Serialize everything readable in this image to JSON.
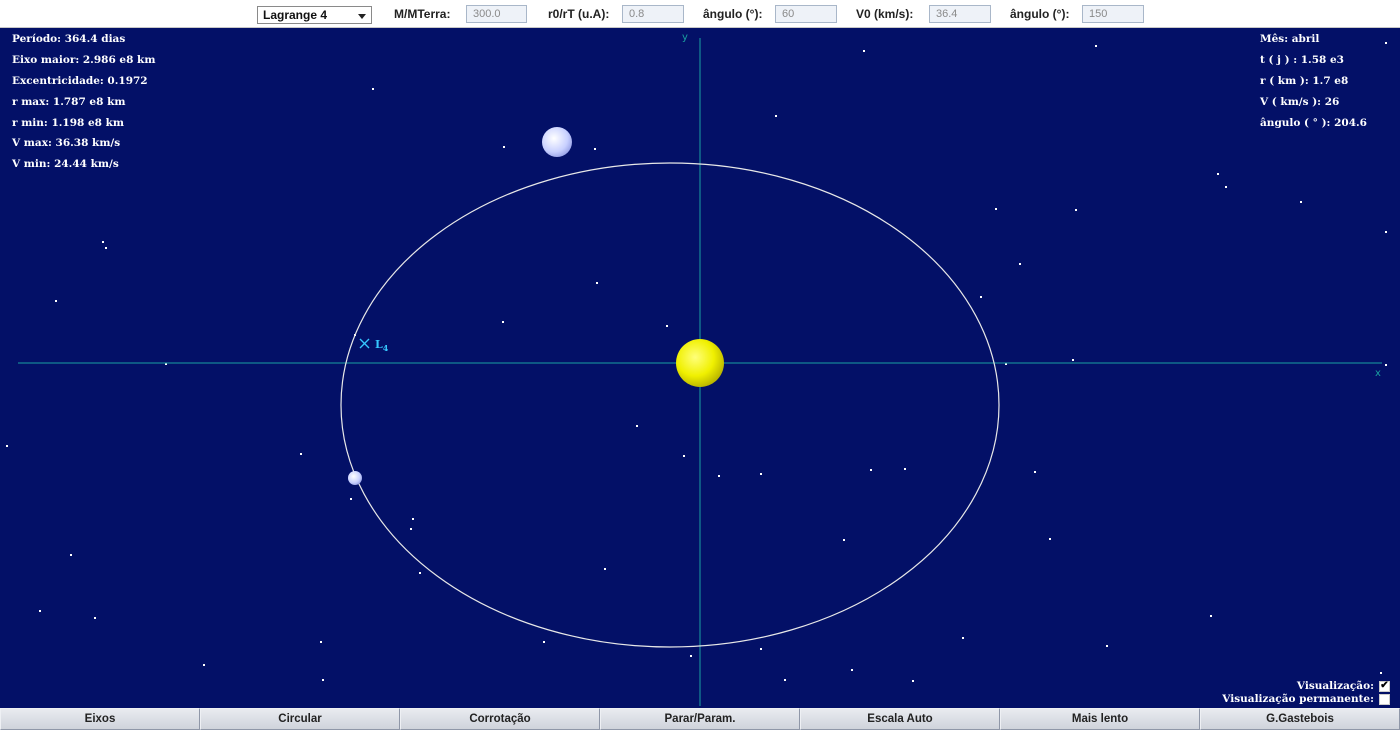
{
  "toolbar": {
    "mode_value": "Lagrange 4",
    "fields": [
      {
        "label": "M/MTerra:",
        "value": "300.0"
      },
      {
        "label": "r0/rT (u.A):",
        "value": "0.8"
      },
      {
        "label": "ângulo (°):",
        "value": "60"
      },
      {
        "label": "V0 (km/s):",
        "value": "36.4"
      },
      {
        "label": "ângulo (°):",
        "value": "150"
      }
    ]
  },
  "info_left": [
    "Período: 364.4 dias",
    "Eixo maior: 2.986 e8 km",
    "Excentricidade: 0.1972",
    "r max: 1.787 e8 km",
    "r min: 1.198 e8 km",
    "V max: 36.38 km/s",
    "V min: 24.44 km/s"
  ],
  "info_right": [
    "Mês: abril",
    "t ( j ) : 1.58 e3",
    "r ( km ): 1.7 e8",
    "V ( km/s ): 26",
    "ângulo ( ° ): 204.6"
  ],
  "axes": {
    "x_label": "x",
    "y_label": "y"
  },
  "lagrange_label": {
    "main": "L",
    "sub": "4"
  },
  "checkboxes": [
    {
      "label": "Visualização:",
      "checked": true
    },
    {
      "label": "Visualização permanente:",
      "checked": false
    }
  ],
  "buttons": [
    "Eixos",
    "Circular",
    "Corrotação",
    "Parar/Param.",
    "Escala Auto",
    "Mais lento",
    "G.Gastebois"
  ],
  "colors": {
    "space": "#031067",
    "sun": "#f0f000",
    "orbit": "#e8e8e8",
    "axis": "#1aa0a0",
    "lagrange": "#36c8ff",
    "planet": "#c8d0ff"
  },
  "icons": {
    "checked": "check-mark-icon",
    "lagrange_point": "cross-marker-icon",
    "dropdown": "chevron-down-icon"
  }
}
